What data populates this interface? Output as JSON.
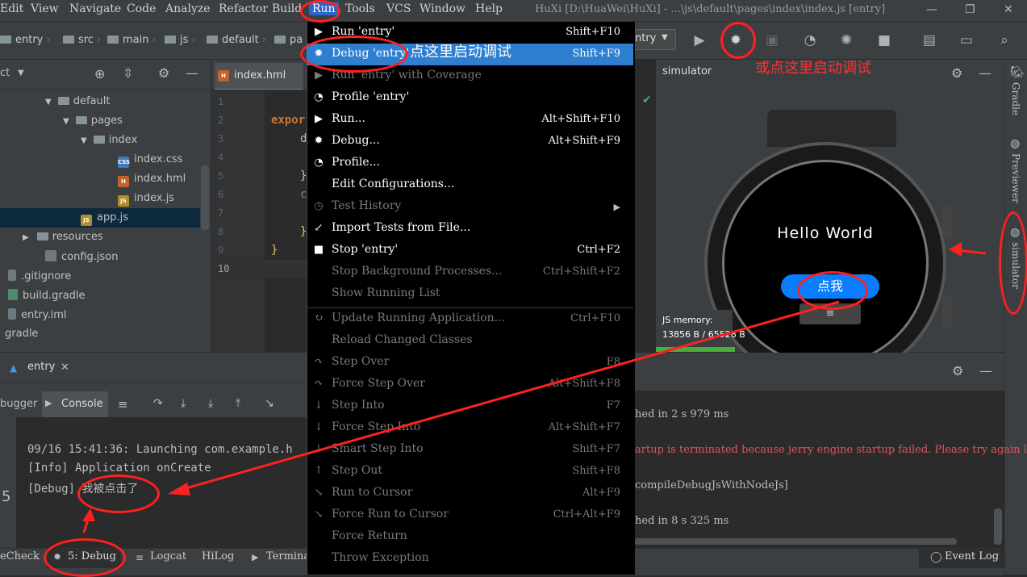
{
  "menubar": {
    "items": [
      "Edit",
      "View",
      "Navigate",
      "Code",
      "Analyze",
      "Refactor",
      "Build",
      "Run",
      "Tools",
      "VCS",
      "Window",
      "Help"
    ],
    "title": "HuXi [D:\\HuaWei\\HuXi] - ...\\js\\default\\pages\\index\\index.js [entry]"
  },
  "navbar": {
    "crumbs": [
      "entry",
      "src",
      "main",
      "js",
      "default",
      "pa"
    ],
    "run_config": "ntry"
  },
  "project": {
    "header": "ct",
    "tree": [
      {
        "label": "default",
        "type": "folder"
      },
      {
        "label": "pages",
        "type": "folder"
      },
      {
        "label": "index",
        "type": "folder"
      },
      {
        "label": "index.css",
        "type": "css"
      },
      {
        "label": "index.hml",
        "type": "hml"
      },
      {
        "label": "index.js",
        "type": "js"
      },
      {
        "label": "app.js",
        "type": "js"
      },
      {
        "label": "resources",
        "type": "folder"
      },
      {
        "label": "config.json",
        "type": "file"
      },
      {
        "label": ".gitignore",
        "type": "file"
      },
      {
        "label": "build.gradle",
        "type": "gradle"
      },
      {
        "label": "entry.iml",
        "type": "file"
      },
      {
        "label": "gradle",
        "type": "folder"
      }
    ]
  },
  "editor": {
    "tab": "index.hml",
    "line_numbers": [
      "1",
      "2",
      "3",
      "4",
      "5",
      "6",
      "7",
      "8",
      "9",
      "10"
    ],
    "code_fragments": [
      "expor",
      "d",
      "}",
      "c",
      "}",
      "}"
    ]
  },
  "run_menu": {
    "items": [
      {
        "label": "Run 'entry'",
        "shortcut": "Shift+F10",
        "enabled": true,
        "icon": "▶"
      },
      {
        "label": "Debug 'entry'",
        "shortcut": "Shift+F9",
        "enabled": true,
        "selected": true,
        "icon": "✹"
      },
      {
        "label": "Run 'entry' with Coverage",
        "shortcut": "",
        "enabled": false,
        "icon": "▶"
      },
      {
        "label": "Profile 'entry'",
        "shortcut": "",
        "enabled": true,
        "icon": "◔"
      },
      {
        "label": "Run...",
        "shortcut": "Alt+Shift+F10",
        "enabled": true,
        "icon": "▶"
      },
      {
        "label": "Debug...",
        "shortcut": "Alt+Shift+F9",
        "enabled": true,
        "icon": "✹"
      },
      {
        "label": "Profile...",
        "shortcut": "",
        "enabled": true,
        "icon": "◔"
      },
      {
        "label": "Edit Configurations...",
        "shortcut": "",
        "enabled": true,
        "icon": ""
      },
      {
        "label": "Test History",
        "shortcut": "",
        "enabled": false,
        "icon": "◷",
        "submenu": true
      },
      {
        "label": "Import Tests from File...",
        "shortcut": "",
        "enabled": true,
        "icon": "↙"
      },
      {
        "label": "Stop 'entry'",
        "shortcut": "Ctrl+F2",
        "enabled": true,
        "icon": "■"
      },
      {
        "label": "Stop Background Processes...",
        "shortcut": "Ctrl+Shift+F2",
        "enabled": false,
        "icon": ""
      },
      {
        "label": "Show Running List",
        "shortcut": "",
        "enabled": false,
        "icon": ""
      },
      {
        "label": "Update Running Application...",
        "shortcut": "Ctrl+F10",
        "enabled": false,
        "icon": "↻"
      },
      {
        "label": "Reload Changed Classes",
        "shortcut": "",
        "enabled": false,
        "icon": ""
      },
      {
        "label": "Step Over",
        "shortcut": "F8",
        "enabled": false,
        "icon": "↷"
      },
      {
        "label": "Force Step Over",
        "shortcut": "Alt+Shift+F8",
        "enabled": false,
        "icon": "↷"
      },
      {
        "label": "Step Into",
        "shortcut": "F7",
        "enabled": false,
        "icon": "↓"
      },
      {
        "label": "Force Step Into",
        "shortcut": "Alt+Shift+F7",
        "enabled": false,
        "icon": "↓"
      },
      {
        "label": "Smart Step Into",
        "shortcut": "Shift+F7",
        "enabled": false,
        "icon": "↓"
      },
      {
        "label": "Step Out",
        "shortcut": "Shift+F8",
        "enabled": false,
        "icon": "↑"
      },
      {
        "label": "Run to Cursor",
        "shortcut": "Alt+F9",
        "enabled": false,
        "icon": "↘"
      },
      {
        "label": "Force Run to Cursor",
        "shortcut": "Ctrl+Alt+F9",
        "enabled": false,
        "icon": "↘"
      },
      {
        "label": "Force Return",
        "shortcut": "",
        "enabled": false,
        "icon": ""
      },
      {
        "label": "Throw Exception",
        "shortcut": "",
        "enabled": false,
        "icon": ""
      }
    ]
  },
  "simulator": {
    "title": "simulator",
    "hello": "Hello World",
    "button": "点我",
    "memory_label": "JS memory:",
    "memory_value": "13856 B / 65528 B"
  },
  "right_strip": [
    "Gradle",
    "Previewer",
    "simulator"
  ],
  "bottom": {
    "run_tab": "entry",
    "tabs": [
      "bugger",
      "Console"
    ],
    "console_lines": [
      "09/16 15:41:36: Launching com.example.h",
      "[Info] Application onCreate",
      "[Debug] 我被点击了"
    ],
    "right_lines": [
      {
        "text": "hed in 2 s 979 ms",
        "error": false
      },
      {
        "text": "artup is terminated because jerry engine startup failed. Please try again lat",
        "error": true
      },
      {
        "text": "compileDebugJsWithNodeJs]",
        "error": false
      },
      {
        "text": "hed in 8 s 325 ms",
        "error": false
      }
    ],
    "status_tabs": [
      "eCheck",
      "5: Debug",
      "Logcat",
      "HiLog",
      "Termina"
    ],
    "event_log": "Event Log"
  },
  "annotations": {
    "debug_here": "点这里启动调试",
    "or_here": "或点这里启动调试"
  },
  "colors": {
    "accent": "#2f65ca",
    "menu_bg": "#000000",
    "selected": "#2f7fd0",
    "annotation": "#ff2020",
    "error_text": "#e05555"
  }
}
